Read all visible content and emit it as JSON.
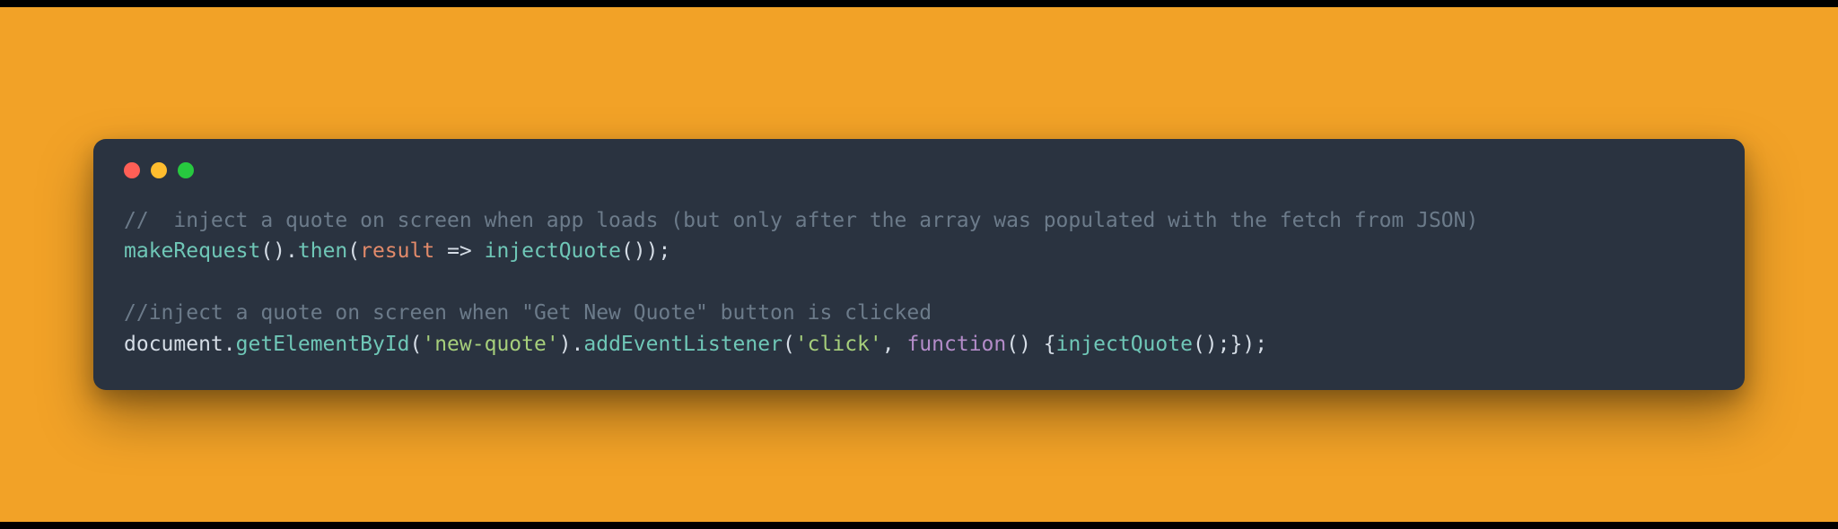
{
  "code": {
    "tokens": [
      {
        "cls": "tok-comment",
        "text": "//  inject a quote on screen when app loads (but only after the array was populated with the fetch from JSON)"
      },
      {
        "cls": "",
        "text": "\n"
      },
      {
        "cls": "tok-method",
        "text": "makeRequest"
      },
      {
        "cls": "tok-default",
        "text": "()."
      },
      {
        "cls": "tok-method",
        "text": "then"
      },
      {
        "cls": "tok-default",
        "text": "("
      },
      {
        "cls": "tok-param",
        "text": "result"
      },
      {
        "cls": "tok-default",
        "text": " => "
      },
      {
        "cls": "tok-method",
        "text": "injectQuote"
      },
      {
        "cls": "tok-default",
        "text": "());"
      },
      {
        "cls": "",
        "text": "\n\n"
      },
      {
        "cls": "tok-comment",
        "text": "//inject a quote on screen when \"Get New Quote\" button is clicked"
      },
      {
        "cls": "",
        "text": "\n"
      },
      {
        "cls": "tok-default",
        "text": "document."
      },
      {
        "cls": "tok-method",
        "text": "getElementById"
      },
      {
        "cls": "tok-default",
        "text": "("
      },
      {
        "cls": "tok-string",
        "text": "'new-quote'"
      },
      {
        "cls": "tok-default",
        "text": ")."
      },
      {
        "cls": "tok-method",
        "text": "addEventListener"
      },
      {
        "cls": "tok-default",
        "text": "("
      },
      {
        "cls": "tok-string",
        "text": "'click'"
      },
      {
        "cls": "tok-default",
        "text": ", "
      },
      {
        "cls": "tok-keyword",
        "text": "function"
      },
      {
        "cls": "tok-default",
        "text": "() {"
      },
      {
        "cls": "tok-method",
        "text": "injectQuote"
      },
      {
        "cls": "tok-default",
        "text": "();});"
      }
    ]
  }
}
